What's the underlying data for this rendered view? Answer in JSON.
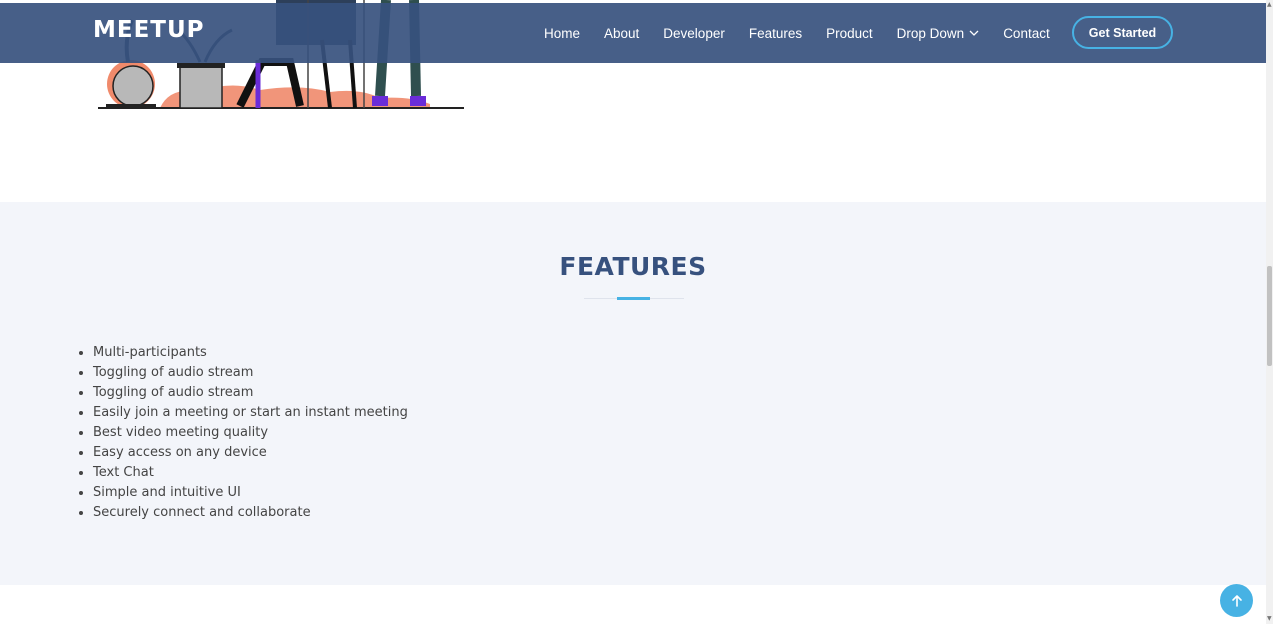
{
  "header": {
    "logo": "MEETUP",
    "nav": [
      {
        "label": "Home"
      },
      {
        "label": "About"
      },
      {
        "label": "Developer"
      },
      {
        "label": "Features"
      },
      {
        "label": "Product"
      },
      {
        "label": "Drop Down"
      },
      {
        "label": "Contact"
      }
    ],
    "cta_label": "Get Started"
  },
  "features": {
    "title": "FEATURES",
    "items": [
      "Multi-participants",
      "Toggling of audio stream",
      "Toggling of audio stream",
      "Easily join a meeting or start an instant meeting",
      "Best video meeting quality",
      "Easy access on any device",
      "Text Chat",
      "Simple and intuitive UI",
      "Securely connect and collaborate"
    ]
  },
  "colors": {
    "header_bg": "#37517e",
    "accent": "#47b2e4",
    "section_bg": "#f3f5fa",
    "title": "#37517e"
  },
  "icons": {
    "dropdown": "chevron-down-icon",
    "back_to_top": "arrow-up-icon"
  }
}
